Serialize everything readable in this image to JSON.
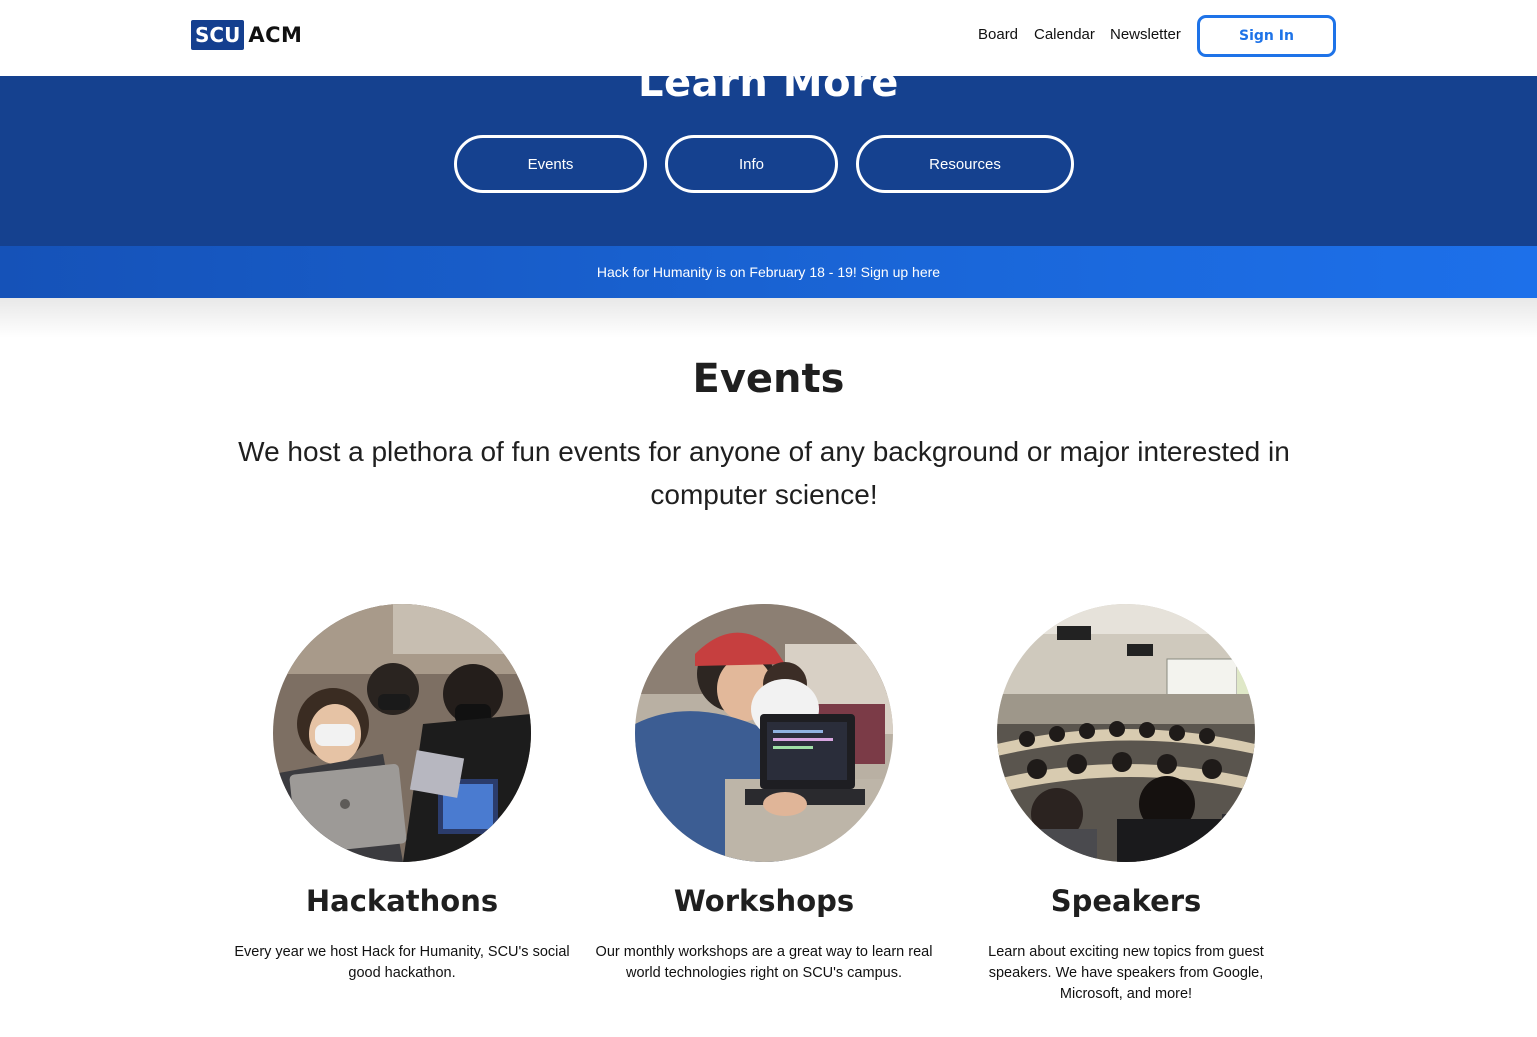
{
  "nav": {
    "logo_box": "SCU",
    "logo_text": "ACM",
    "links": [
      "Board",
      "Calendar",
      "Newsletter"
    ],
    "signin": "Sign In"
  },
  "hero": {
    "title": "Learn More",
    "buttons": [
      "Events",
      "Info",
      "Resources"
    ]
  },
  "banner": {
    "text": "Hack for Humanity is on February 18 - 19! Sign up here"
  },
  "events": {
    "title": "Events",
    "description": "We host a plethora of fun events for anyone of any background or major interested in computer science!",
    "cards": [
      {
        "title": "Hackathons",
        "description": "Every year we host Hack for Humanity, SCU's social good hackathon.",
        "image": "hackathon-photo"
      },
      {
        "title": "Workshops",
        "description": "Our monthly workshops are a great way to learn real world technologies right on SCU's campus.",
        "image": "workshop-photo"
      },
      {
        "title": "Speakers",
        "description": "Learn about exciting new topics from guest speakers. We have speakers from Google, Microsoft, and more!",
        "image": "speakers-photo"
      }
    ]
  },
  "colors": {
    "brand_blue": "#15418f",
    "banner_blue": "#1a66d8",
    "signin_blue": "#1e73e8"
  }
}
